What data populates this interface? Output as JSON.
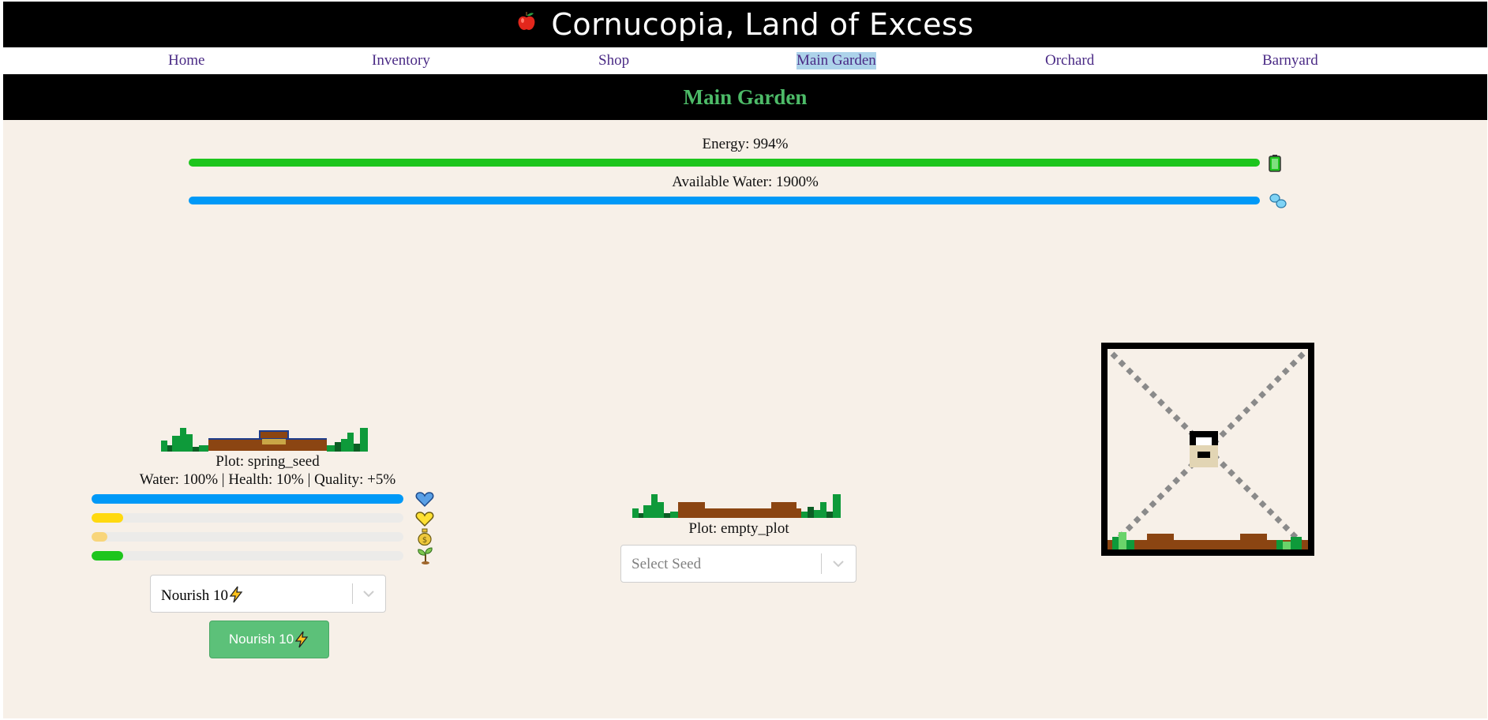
{
  "app": {
    "title": "Cornucopia, Land of Excess",
    "logo_icon": "apple-icon"
  },
  "nav": {
    "items": [
      {
        "label": "Home"
      },
      {
        "label": "Inventory"
      },
      {
        "label": "Shop"
      },
      {
        "label": "Main Garden",
        "active": true
      },
      {
        "label": "Orchard"
      },
      {
        "label": "Barnyard"
      }
    ]
  },
  "page": {
    "heading": "Main Garden"
  },
  "stats": {
    "energy": {
      "label": "Energy: 994%",
      "color": "#1dc51d",
      "icon": "battery-icon"
    },
    "water": {
      "label": "Available Water: 1900%",
      "color": "#0099f7",
      "icon": "water-drops-icon"
    }
  },
  "plots": [
    {
      "name": "Plot: spring_seed",
      "details": "Water: 100% | Health: 10% | Quality: +5%",
      "meters": [
        {
          "icon": "heart-blue-icon",
          "color": "#0099f7",
          "level": 1.0
        },
        {
          "icon": "heart-yellow-icon",
          "color": "#ffd90f",
          "level": 0.1
        },
        {
          "icon": "money-bag-icon",
          "color": "#f8d57a",
          "level": 0.05
        },
        {
          "icon": "sprout-icon",
          "color": "#1dc51d",
          "level": 0.1
        }
      ],
      "action_select": "Nourish 10",
      "action_button": "Nourish 10"
    },
    {
      "name": "Plot: empty_plot",
      "seed_placeholder": "Select Seed"
    }
  ],
  "colors": {
    "soil": "#8b4512",
    "grass": "#0e9a3a",
    "nav_link": "#4a2a85",
    "heading": "#4dbb68"
  }
}
